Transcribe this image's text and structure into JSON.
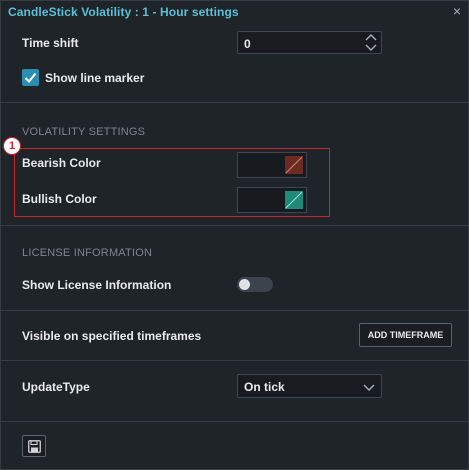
{
  "window": {
    "title": "CandleStick Volatility : 1 - Hour settings",
    "close_glyph": "×",
    "close_icon": "close-icon"
  },
  "general": {
    "time_shift_label": "Time shift",
    "time_shift_value": "0",
    "show_line_marker_label": "Show line marker",
    "show_line_marker_checked": true
  },
  "volatility": {
    "section_title": "VOLATILITY SETTINGS",
    "annotation_number": "1",
    "bearish_label": "Bearish Color",
    "bearish_color": "#6b2a22",
    "bullish_label": "Bullish Color",
    "bullish_color": "#1f8a78"
  },
  "license": {
    "section_title": "LICENSE INFORMATION",
    "show_license_label": "Show License Information",
    "show_license_on": false
  },
  "timeframes": {
    "label": "Visible on specified timeframes",
    "button_label": "ADD TIMEFRAME"
  },
  "update": {
    "label": "UpdateType",
    "selected": "On tick"
  },
  "footer": {
    "save_icon": "save-icon"
  },
  "colors": {
    "accent": "#5cc0d8",
    "checkbox": "#2a8db1",
    "highlight": "#c8232c"
  }
}
